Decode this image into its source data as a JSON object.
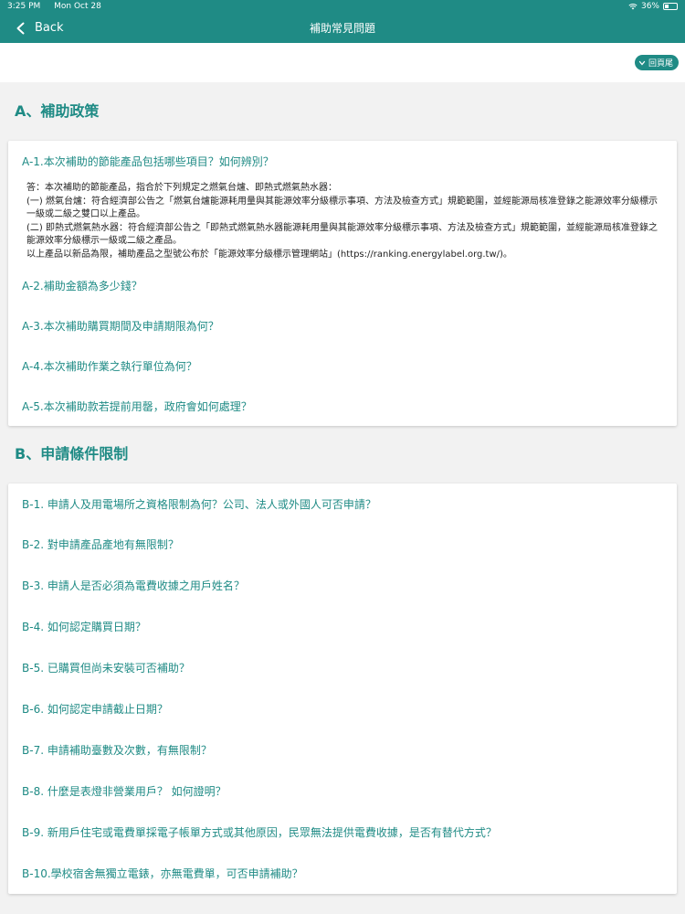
{
  "status": {
    "time": "3:25 PM",
    "date": "Mon Oct 28",
    "battery": "36%",
    "battery_level": 0.36
  },
  "nav": {
    "back_label": "Back",
    "title": "補助常見問題"
  },
  "tofooter_label": "回頁尾",
  "sections": [
    {
      "title": "A、補助政策",
      "items": [
        {
          "q": "A-1.本次補助的節能產品包括哪些項目？如何辨別？",
          "answer": [
            "答：本次補助的節能產品，指合於下列規定之燃氣台爐、即熱式燃氣熱水器：",
            "(一) 燃氣台爐：符合經濟部公告之「燃氣台爐能源耗用量與其能源效率分級標示事項、方法及檢查方式」規範範圍，並經能源局核准登錄之能源效率分級標示一級或二級之雙口以上產品。",
            "(二) 即熱式燃氣熱水器：符合經濟部公告之「即熱式燃氣熱水器能源耗用量與其能源效率分級標示事項、方法及檢查方式」規範範圍，並經能源局核准登錄之能源效率分級標示一級或二級之產品。",
            "以上產品以新品為限，補助產品之型號公布於「能源效率分級標示管理網站」(https://ranking.energylabel.org.tw/)。"
          ]
        },
        {
          "q": "A-2.補助金額為多少錢？"
        },
        {
          "q": "A-3.本次補助購買期間及申請期限為何？"
        },
        {
          "q": "A-4.本次補助作業之執行單位為何？"
        },
        {
          "q": "A-5.本次補助款若提前用罄，政府會如何處理？"
        }
      ]
    },
    {
      "title": "B、申請條件限制",
      "items": [
        {
          "q": "B-1. 申請人及用電場所之資格限制為何？公司、法人或外國人可否申請？"
        },
        {
          "q": "B-2. 對申請產品產地有無限制？"
        },
        {
          "q": "B-3. 申請人是否必須為電費收據之用戶姓名？"
        },
        {
          "q": "B-4. 如何認定購買日期？"
        },
        {
          "q": "B-5. 已購買但尚未安裝可否補助？"
        },
        {
          "q": "B-6. 如何認定申請截止日期？"
        },
        {
          "q": "B-7. 申請補助臺數及次數，有無限制？"
        },
        {
          "q": "B-8. 什麼是表燈非營業用戶？ 如何證明？"
        },
        {
          "q": "B-9. 新用戶住宅或電費單採電子帳單方式或其他原因，民眾無法提供電費收據，是否有替代方式？"
        },
        {
          "q": "B-10.學校宿舍無獨立電錶，亦無電費單，可否申請補助？"
        }
      ]
    }
  ],
  "colors": {
    "accent": "#1f8b85",
    "background": "#f2f2f2"
  }
}
